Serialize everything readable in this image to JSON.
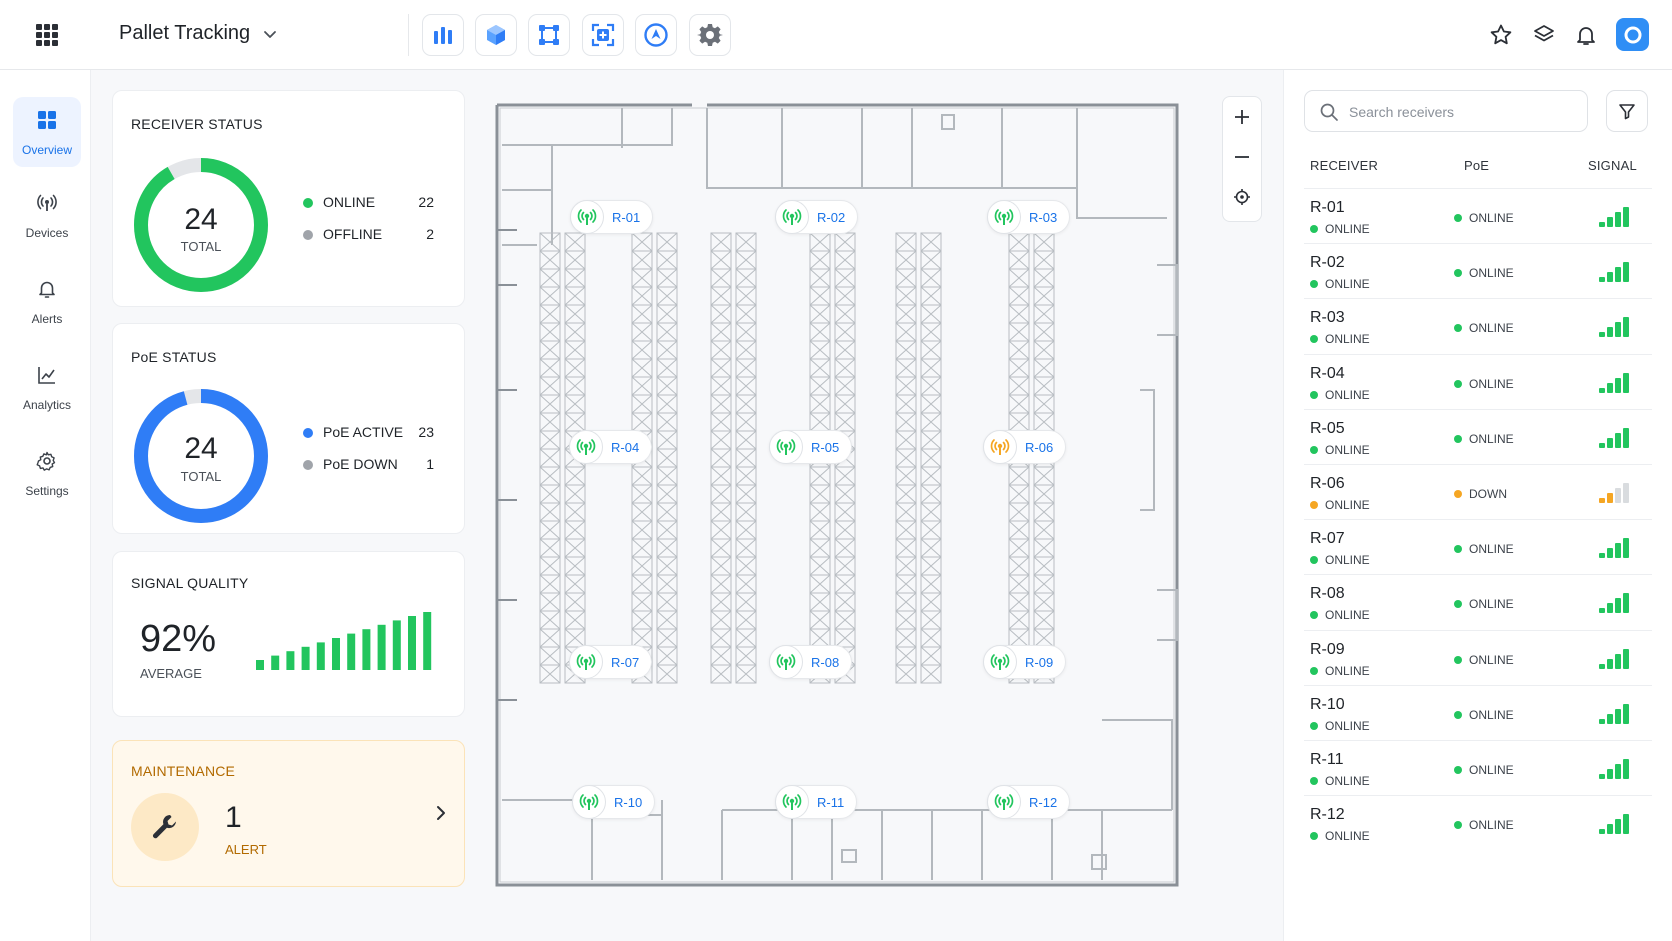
{
  "app": {
    "title": "Pallet Tracking"
  },
  "toolbar": {
    "tools": [
      {
        "icon": "bar-chart-icon"
      },
      {
        "icon": "cube-icon"
      },
      {
        "icon": "selection-box-icon"
      },
      {
        "icon": "focus-target-icon"
      },
      {
        "icon": "navigation-icon"
      },
      {
        "icon": "gear-icon"
      }
    ],
    "right_icons": [
      "star-icon",
      "layers-icon",
      "bell-icon",
      "avatar"
    ]
  },
  "sidebar": {
    "items": [
      {
        "label": "Overview",
        "icon": "overview-grid-icon",
        "active": true
      },
      {
        "label": "Devices",
        "icon": "antenna-icon",
        "active": false
      },
      {
        "label": "Alerts",
        "icon": "bell-icon",
        "active": false
      },
      {
        "label": "Analytics",
        "icon": "line-chart-icon",
        "active": false
      },
      {
        "label": "Settings",
        "icon": "gear-icon",
        "active": false
      }
    ]
  },
  "receiver_status": {
    "title": "RECEIVER STATUS",
    "total": "24",
    "total_label": "TOTAL",
    "online_label": "ONLINE",
    "online_value": "22",
    "offline_label": "OFFLINE",
    "offline_value": "2",
    "online_fraction": 0.9167
  },
  "poe_status": {
    "title": "PoE STATUS",
    "total": "24",
    "total_label": "TOTAL",
    "active_label": "PoE ACTIVE",
    "active_value": "23",
    "down_label": "PoE DOWN",
    "down_value": "1",
    "active_fraction": 0.9583
  },
  "signal_quality": {
    "title": "SIGNAL QUALITY",
    "value": "92%",
    "label": "AVERAGE"
  },
  "maintenance": {
    "title": "MAINTENANCE",
    "count": "1",
    "label": "ALERT"
  },
  "map": {
    "receivers": [
      "R-01",
      "R-02",
      "R-03",
      "R-04",
      "R-05",
      "R-06",
      "R-07",
      "R-08",
      "R-09",
      "R-10",
      "R-11",
      "R-12"
    ],
    "warning_receiver": "R-06"
  },
  "panel": {
    "search_placeholder": "Search receivers",
    "col_receiver": "RECEIVER",
    "col_poe": "PoE",
    "col_signal": "SIGNAL",
    "rows": [
      {
        "name": "R-01",
        "status": "ONLINE",
        "poe": "ONLINE",
        "signal": 4
      },
      {
        "name": "R-02",
        "status": "ONLINE",
        "poe": "ONLINE",
        "signal": 4
      },
      {
        "name": "R-03",
        "status": "ONLINE",
        "poe": "ONLINE",
        "signal": 4
      },
      {
        "name": "R-04",
        "status": "ONLINE",
        "poe": "ONLINE",
        "signal": 4
      },
      {
        "name": "R-05",
        "status": "ONLINE",
        "poe": "ONLINE",
        "signal": 4
      },
      {
        "name": "R-06",
        "status": "ONLINE",
        "poe": "DOWN",
        "signal": 2
      },
      {
        "name": "R-07",
        "status": "ONLINE",
        "poe": "ONLINE",
        "signal": 4
      },
      {
        "name": "R-08",
        "status": "ONLINE",
        "poe": "ONLINE",
        "signal": 4
      },
      {
        "name": "R-09",
        "status": "ONLINE",
        "poe": "ONLINE",
        "signal": 4
      },
      {
        "name": "R-10",
        "status": "ONLINE",
        "poe": "ONLINE",
        "signal": 4
      },
      {
        "name": "R-11",
        "status": "ONLINE",
        "poe": "ONLINE",
        "signal": 4
      },
      {
        "name": "R-12",
        "status": "ONLINE",
        "poe": "ONLINE",
        "signal": 4
      }
    ]
  },
  "colors": {
    "accent": "#1a73e8",
    "online": "#22c55e",
    "warning": "#f5a623",
    "offline": "#a0a4aa",
    "poe_active": "#2f7df6"
  }
}
